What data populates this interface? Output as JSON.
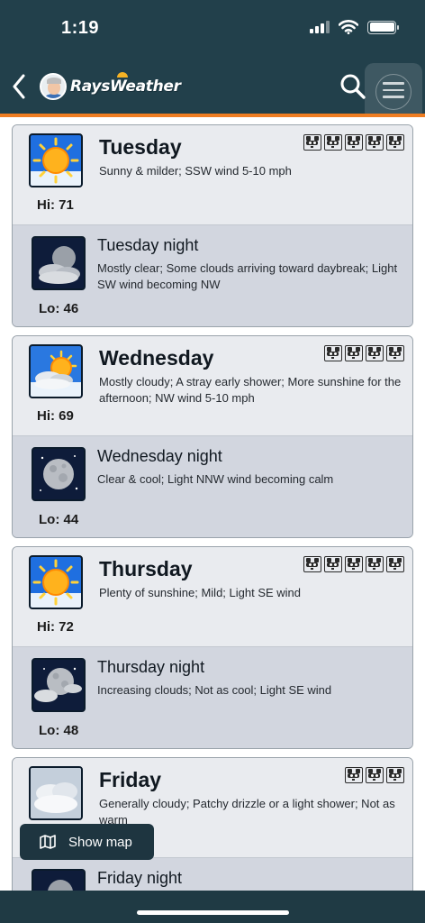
{
  "status_bar": {
    "time": "1:19"
  },
  "header": {
    "app_name": "RaysWeather"
  },
  "colors": {
    "header_bg": "#22404b",
    "accent": "#ef7d22",
    "day_bg": "#e9ebef",
    "night_bg": "#d2d6df"
  },
  "forecast": [
    {
      "day": "Tuesday",
      "day_icon": "sunny-icon",
      "day_desc": "Sunny & milder; SSW wind 5-10 mph",
      "hi": "Hi: 71",
      "rating": 5,
      "night": "Tuesday night",
      "night_icon": "partly-cloudy-night-icon",
      "night_desc": "Mostly clear; Some clouds arriving toward daybreak; Light SW wind becoming NW",
      "lo": "Lo: 46"
    },
    {
      "day": "Wednesday",
      "day_icon": "partly-sunny-icon",
      "day_desc": "Mostly cloudy; A stray early shower; More sunshine for the afternoon; NW wind 5-10 mph",
      "hi": "Hi: 69",
      "rating": 4,
      "night": "Wednesday night",
      "night_icon": "clear-night-icon",
      "night_desc": "Clear & cool; Light NNW wind becoming calm",
      "lo": "Lo: 44"
    },
    {
      "day": "Thursday",
      "day_icon": "sunny-icon",
      "day_desc": "Plenty of sunshine; Mild; Light SE wind",
      "hi": "Hi: 72",
      "rating": 5,
      "night": "Thursday night",
      "night_icon": "increasing-clouds-night-icon",
      "night_desc": "Increasing clouds; Not as cool; Light SE wind",
      "lo": "Lo: 48"
    },
    {
      "day": "Friday",
      "day_icon": "cloudy-icon",
      "day_desc": "Generally cloudy; Patchy drizzle or a light shower; Not as warm",
      "hi": "",
      "rating": 3,
      "night": "Friday night",
      "night_icon": "cloudy-night-icon",
      "night_desc": "",
      "lo": ""
    }
  ],
  "show_map": {
    "label": "Show map"
  }
}
